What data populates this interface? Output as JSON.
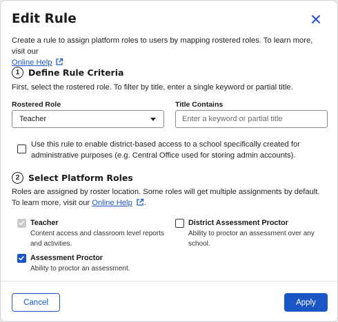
{
  "dialog": {
    "title": "Edit Rule",
    "intro_text": "Create a rule to assign platform roles to users by mapping rostered roles. To learn more, visit our",
    "intro_link": "Online Help"
  },
  "section1": {
    "number": "1",
    "title": "Define Rule Criteria",
    "description": "First, select the rostered role. To filter by title, enter a single keyword or partial title.",
    "rostered_role_label": "Rostered Role",
    "rostered_role_value": "Teacher",
    "title_contains_label": "Title Contains",
    "title_contains_placeholder": "Enter a keyword or partial title",
    "title_contains_value": "",
    "district_access_checkbox_label": "Use this rule to enable district-based access to a school specifically created for administrative purposes (e.g. Central Office used for storing admin accounts).",
    "district_access_checked": false
  },
  "section2": {
    "number": "2",
    "title": "Select Platform Roles",
    "description": "Roles are assigned by roster location. Some roles will get multiple assignments by default. To learn more, visit our",
    "link": "Online Help",
    "roles": [
      {
        "name": "Teacher",
        "description": "Content access and classroom level reports and activities.",
        "checked": true,
        "disabled": true
      },
      {
        "name": "District Assessment Proctor",
        "description": "Ability to proctor an assessment over any school.",
        "checked": false,
        "disabled": false
      },
      {
        "name": "Assessment Proctor",
        "description": "Ability to proctor an assessment.",
        "checked": true,
        "disabled": false
      }
    ]
  },
  "footer": {
    "cancel_label": "Cancel",
    "apply_label": "Apply"
  },
  "colors": {
    "accent": "#1a56c5",
    "disabled_check": "#c9c9cc"
  },
  "icons": [
    "close-icon",
    "external-link-icon",
    "chevron-down-icon",
    "checkmark-icon"
  ]
}
